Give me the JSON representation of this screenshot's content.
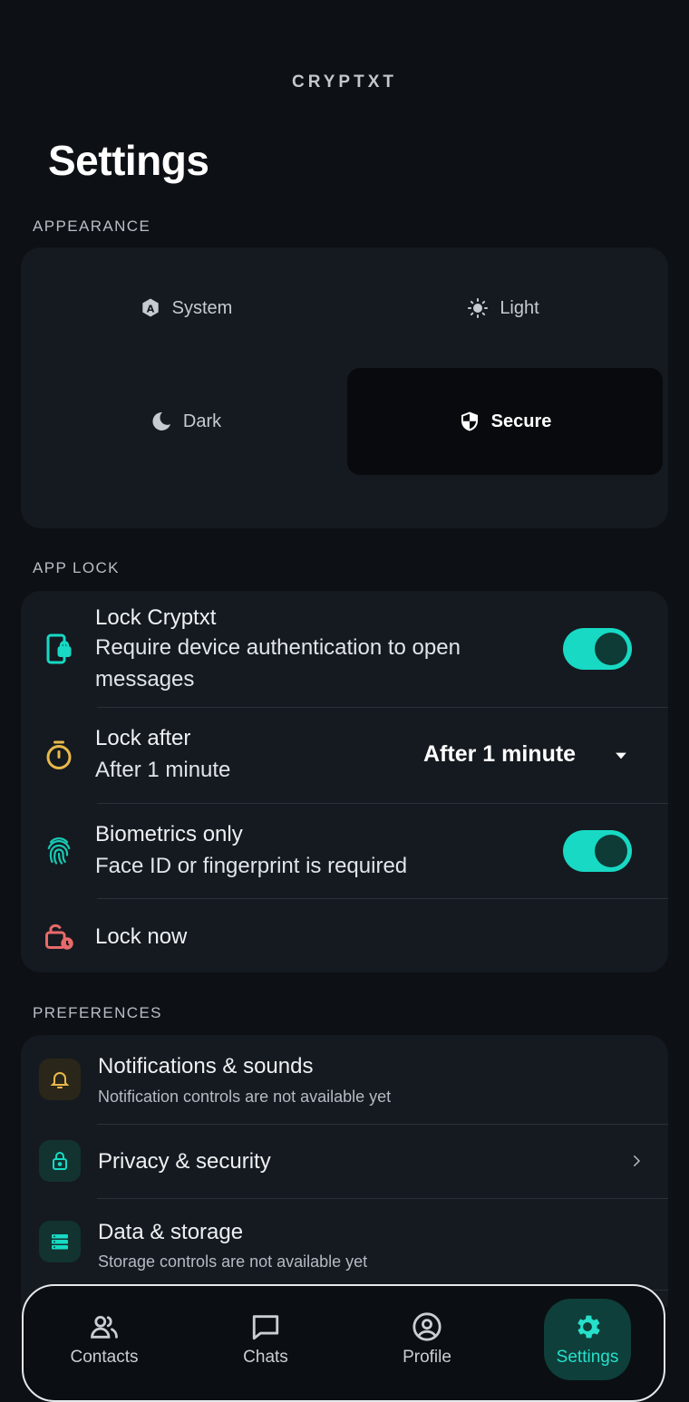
{
  "app": {
    "brand": "CRYPTXT",
    "page_title": "Settings"
  },
  "appearance": {
    "section_label": "APPEARANCE",
    "options": [
      {
        "label": "System",
        "icon": "auto-theme-icon"
      },
      {
        "label": "Light",
        "icon": "sun-icon"
      },
      {
        "label": "Dark",
        "icon": "moon-icon"
      },
      {
        "label": "Secure",
        "icon": "shield-icon",
        "selected": true
      }
    ]
  },
  "app_lock": {
    "section_label": "APP LOCK",
    "lock_app": {
      "title": "Lock Cryptxt",
      "subtitle": "Require device authentication to open messages",
      "enabled": true,
      "icon": "phone-lock-icon"
    },
    "lock_after": {
      "title": "Lock after",
      "subtitle": "After 1 minute",
      "value": "After 1 minute",
      "icon": "timer-icon"
    },
    "biometrics": {
      "title": "Biometrics only",
      "subtitle": "Face ID or fingerprint is required",
      "enabled": true,
      "icon": "fingerprint-icon"
    },
    "lock_now": {
      "title": "Lock now",
      "icon": "lock-clock-icon"
    }
  },
  "preferences": {
    "section_label": "PREFERENCES",
    "items": [
      {
        "title": "Notifications & sounds",
        "subtitle": "Notification controls are not available yet",
        "icon": "bell-icon"
      },
      {
        "title": "Privacy & security",
        "subtitle": "",
        "icon": "lock-icon"
      },
      {
        "title": "Data & storage",
        "subtitle": "Storage controls are not available yet",
        "icon": "storage-icon"
      }
    ]
  },
  "nav": {
    "items": [
      {
        "label": "Contacts",
        "icon": "contacts-icon"
      },
      {
        "label": "Chats",
        "icon": "chat-icon"
      },
      {
        "label": "Profile",
        "icon": "profile-icon"
      },
      {
        "label": "Settings",
        "icon": "gear-icon",
        "active": true
      }
    ]
  },
  "colors": {
    "accent": "#17d9c4",
    "background": "#0d1116",
    "card": "#151a20"
  }
}
